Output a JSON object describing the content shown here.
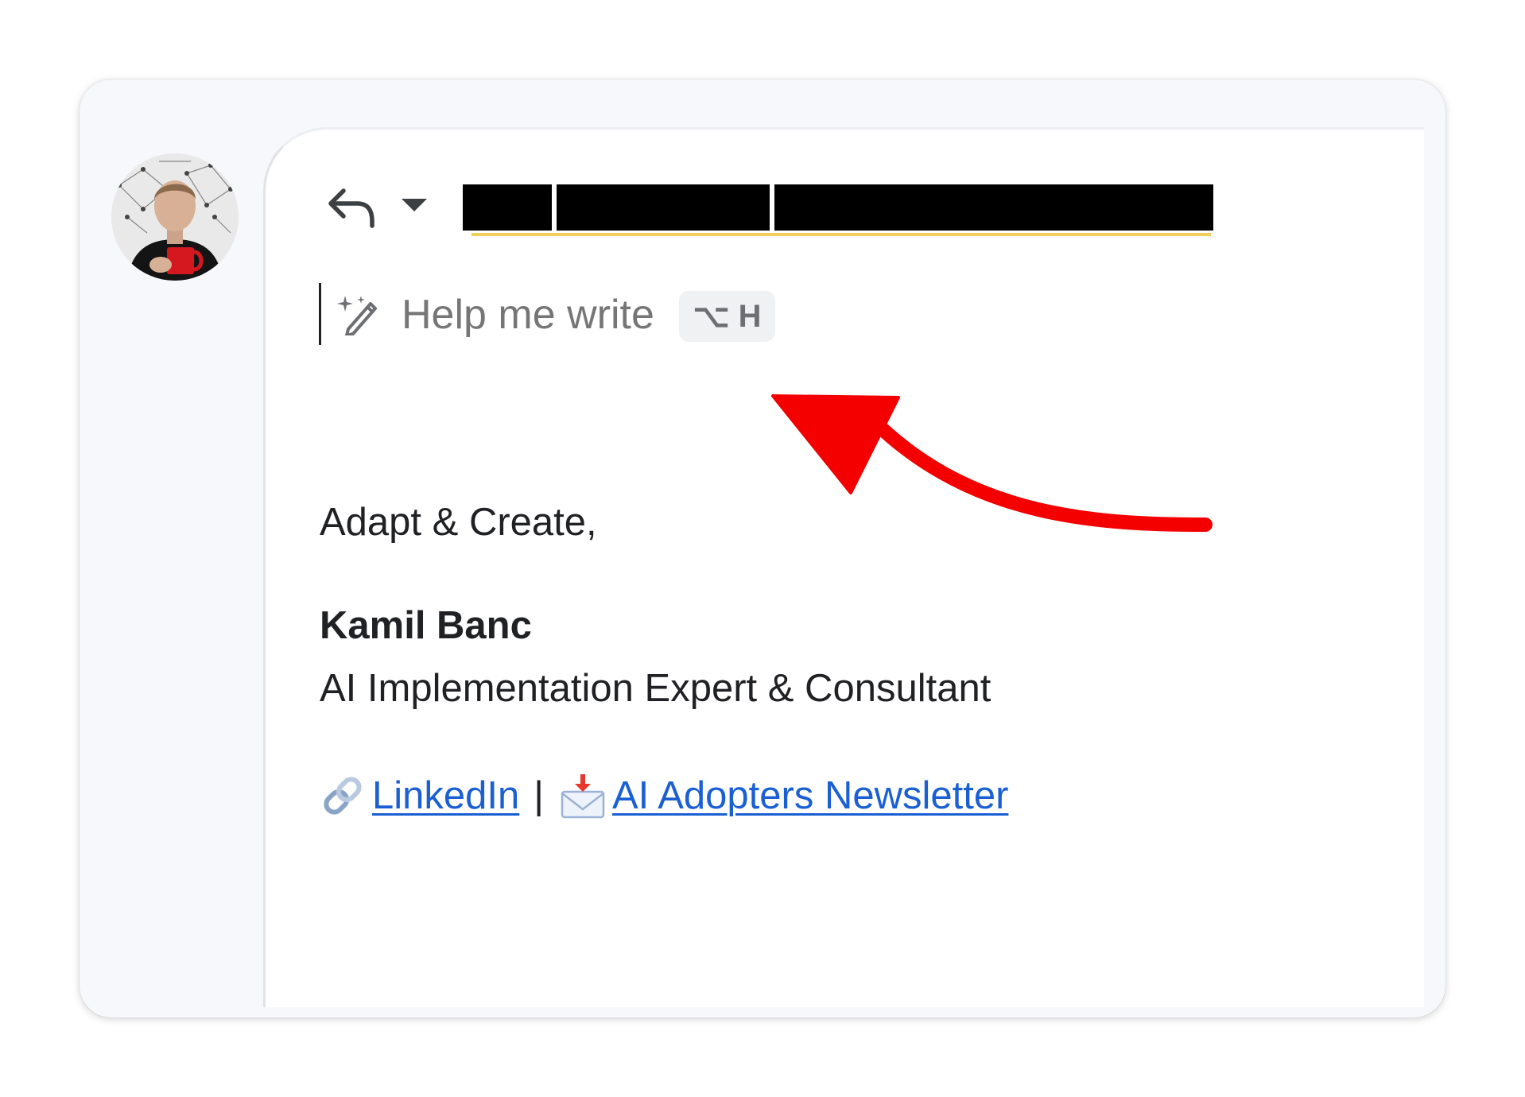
{
  "compose": {
    "help_me_write_label": "Help me write",
    "help_me_write_shortcut": "⌥ H",
    "signoff": "Adapt & Create,",
    "signature_name": "Kamil Banc",
    "signature_title": "AI Implementation Expert & Consultant",
    "links": {
      "linkedin_label": " LinkedIn",
      "separator": "|",
      "newsletter_label": " AI Adopters Newsletter"
    }
  },
  "annotation": {
    "arrow_color": "#f40000"
  },
  "colors": {
    "link": "#1a5fd4",
    "recipient_underline": "#f2cf5b",
    "text": "#202124",
    "placeholder": "#767676"
  },
  "icons": {
    "reply": "reply-icon",
    "dropdown": "chevron-down-icon",
    "help_me_write": "magic-pencil-icon",
    "linkedin": "link-icon",
    "newsletter": "envelope-download-icon"
  }
}
